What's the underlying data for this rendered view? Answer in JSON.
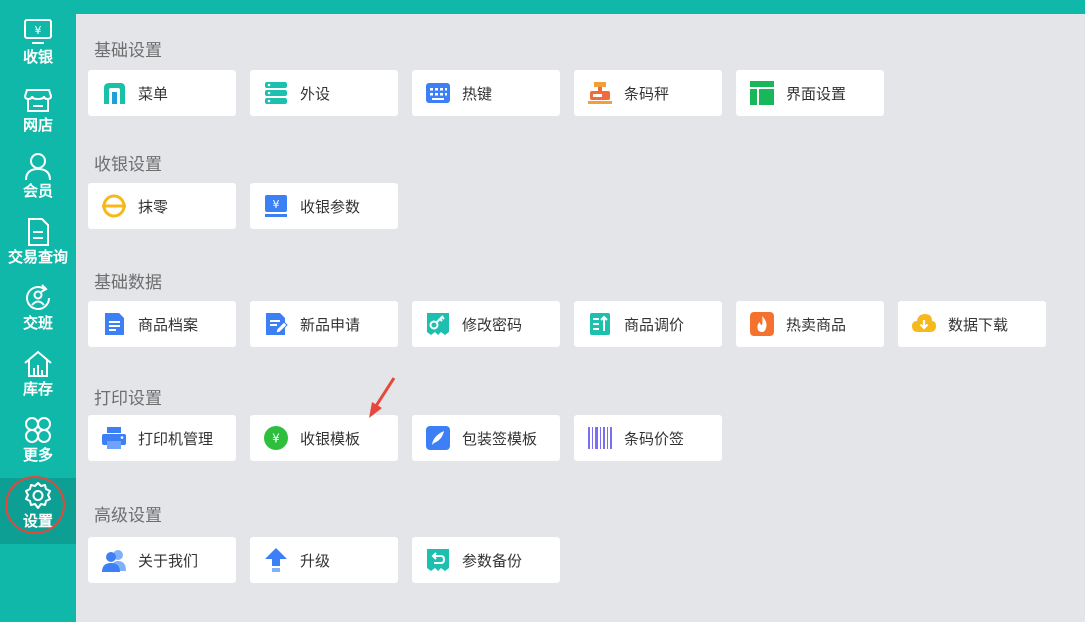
{
  "sidebar": {
    "items": [
      {
        "label": "收银",
        "icon": "cash-register-icon"
      },
      {
        "label": "网店",
        "icon": "shop-icon"
      },
      {
        "label": "会员",
        "icon": "member-icon"
      },
      {
        "label": "交易查询",
        "icon": "transaction-icon"
      },
      {
        "label": "交班",
        "icon": "shift-icon"
      },
      {
        "label": "库存",
        "icon": "inventory-icon"
      },
      {
        "label": "更多",
        "icon": "more-icon"
      },
      {
        "label": "设置",
        "icon": "settings-icon",
        "active": true
      }
    ]
  },
  "sections": {
    "basic_settings": {
      "title": "基础设置",
      "items": [
        {
          "label": "菜单",
          "icon": "menu-icon"
        },
        {
          "label": "外设",
          "icon": "peripheral-icon"
        },
        {
          "label": "热键",
          "icon": "keyboard-icon"
        },
        {
          "label": "条码秤",
          "icon": "scale-icon"
        },
        {
          "label": "界面设置",
          "icon": "layout-icon"
        }
      ]
    },
    "cashier_settings": {
      "title": "收银设置",
      "items": [
        {
          "label": "抹零",
          "icon": "rounding-icon"
        },
        {
          "label": "收银参数",
          "icon": "cashier-params-icon"
        }
      ]
    },
    "basic_data": {
      "title": "基础数据",
      "items": [
        {
          "label": "商品档案",
          "icon": "product-file-icon"
        },
        {
          "label": "新品申请",
          "icon": "new-product-icon"
        },
        {
          "label": "修改密码",
          "icon": "password-key-icon"
        },
        {
          "label": "商品调价",
          "icon": "price-adjust-icon"
        },
        {
          "label": "热卖商品",
          "icon": "hot-icon"
        },
        {
          "label": "数据下载",
          "icon": "download-icon"
        }
      ]
    },
    "print_settings": {
      "title": "打印设置",
      "items": [
        {
          "label": "打印机管理",
          "icon": "printer-icon"
        },
        {
          "label": "收银模板",
          "icon": "cashier-template-icon"
        },
        {
          "label": "包装签模板",
          "icon": "label-template-icon"
        },
        {
          "label": "条码价签",
          "icon": "barcode-icon"
        }
      ]
    },
    "advanced_settings": {
      "title": "高级设置",
      "items": [
        {
          "label": "关于我们",
          "icon": "about-icon"
        },
        {
          "label": "升级",
          "icon": "upgrade-icon"
        },
        {
          "label": "参数备份",
          "icon": "backup-icon"
        }
      ]
    }
  },
  "colors": {
    "sidebar": "#10b8aa",
    "sidebar_active": "#0e9f94",
    "background": "#e4e5e9",
    "highlight": "#e5483a"
  }
}
